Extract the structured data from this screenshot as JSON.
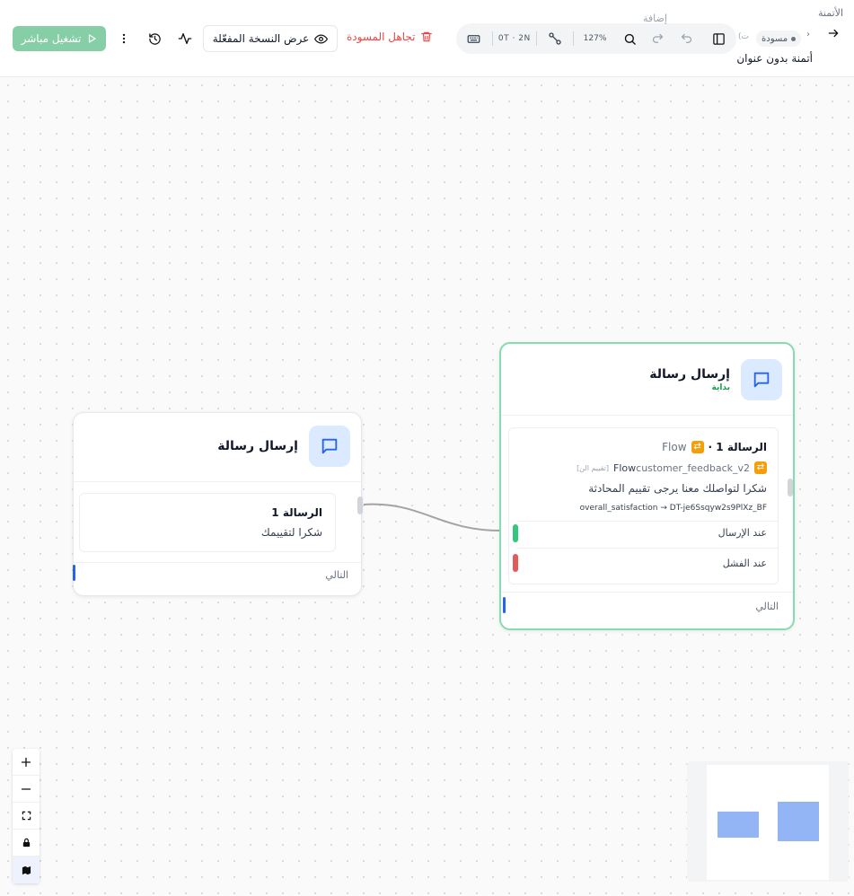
{
  "header": {
    "run_label": "تشغيل مباشر",
    "view_published_label": "عرض النسخة المفعّلة",
    "discard_label": "تجاهل المسودة",
    "zoom_level": "127%",
    "shortcut_label": "0T · 2N",
    "breadcrumb_top": "الأتمنة",
    "ghost_label": "إضافة",
    "draft_label": "مسودة",
    "draft_extra": "(ت",
    "automation_title": "أتمنة بدون عنوان"
  },
  "nodes": {
    "left": {
      "title": "إرسال رسالة",
      "message_title": "الرسالة 1",
      "message_text": "شكرا لتقييمك",
      "next_label": "التالي"
    },
    "right": {
      "title": "إرسال رسالة",
      "subtitle": "بداية",
      "message_title": "الرسالة 1 ·",
      "flow_word": "Flow",
      "flow_line_prefix": "Flow",
      "flow_name": "customer_feedback_v2",
      "flow_tag": "[تقييم الن]",
      "message_text": "شكرا لتواصلك معنا يرجى تقييم المحادثة",
      "mapping": "overall_satisfaction → DT-je6Ssqyw2s9PlXz_BF",
      "on_send": "عند الإرسال",
      "on_fail": "عند الفشل",
      "next_label": "التالي"
    }
  },
  "colors": {
    "accent_green": "#86dcae",
    "run_button": "#86cfa6",
    "discard_red": "#ef4444",
    "node_icon_bg": "#dbeafe",
    "node_icon_blue": "#2563eb",
    "minimap_node": "#93b4f5"
  },
  "icons": {
    "run": "play-icon",
    "more": "more-vertical-icon",
    "history": "history-icon",
    "activity": "activity-icon",
    "view": "eye-icon",
    "discard": "trash-icon",
    "keyboard": "keyboard-icon",
    "connect": "connector-icon",
    "search": "search-icon",
    "redo": "redo-icon",
    "undo": "undo-icon",
    "panel": "panel-icon",
    "back": "arrow-right-icon",
    "message": "message-square-icon",
    "flow": "flow-icon"
  }
}
